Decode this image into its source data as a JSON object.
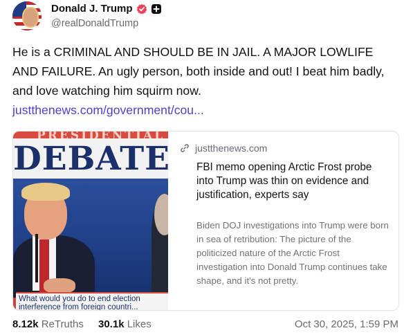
{
  "author": {
    "display_name": "Donald J. Trump",
    "handle": "@realDonaldTrump",
    "verified_icon": "verified-badge-icon",
    "extra_icon": "plus-square-icon"
  },
  "post": {
    "text": "He is a CRIMINAL AND SHOULD BE IN JAIL. A MAJOR LOWLIFE AND FAILURE. An ugly person, both inside and out! I beat him badly, and love watching him squirm now.",
    "link_text": "justthenews.com/government/cou..."
  },
  "card": {
    "domain": "justthenews.com",
    "title": "FBI memo opening Arctic Frost probe into Trump was thin on evidence and justification, experts say",
    "description": "Biden DOJ investigations into Trump were born in sea of retribution: The picture of the politicized nature of the Arctic Frost investigation into Donald Trump continues take shape, and it's not pretty.",
    "image": {
      "banner_text": "PRESIDENTIAL",
      "headline_text": "DEBATE",
      "caption_line1": "What would you do to end election",
      "caption_line2": "interference from foreign countri..."
    }
  },
  "stats": {
    "retruths_count": "8.12k",
    "retruths_label": "ReTruths",
    "likes_count": "30.1k",
    "likes_label": "Likes",
    "timestamp": "Oct 30, 2025, 1:59 PM"
  },
  "colors": {
    "link": "#4f3fd1",
    "muted": "#666a73",
    "verified": "#e8445a"
  }
}
